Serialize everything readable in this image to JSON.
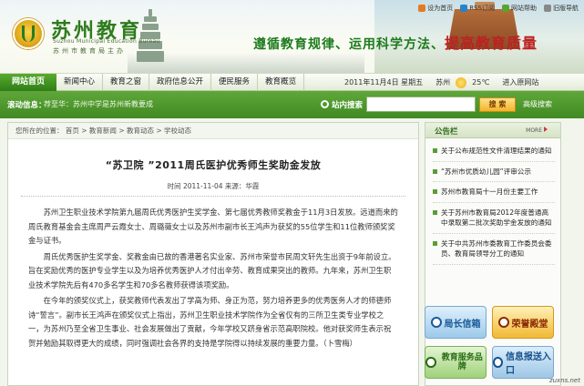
{
  "header": {
    "site_title": "苏州教育",
    "site_title_en": "Suzhou Municipal Education Bureau",
    "site_subtitle": "苏州市教育局主办",
    "slogan_part1": "遵循教育规律、运用科学方法、",
    "slogan_part2": "提高教育质量",
    "top_links": [
      {
        "label": "设为首页",
        "icon": "home-icon"
      },
      {
        "label": "RSS订阅",
        "icon": "rss-icon"
      },
      {
        "label": "网站帮助",
        "icon": "help-icon"
      },
      {
        "label": "旧版导航",
        "icon": "nav-icon"
      }
    ]
  },
  "nav": {
    "home": "网站首页",
    "items": [
      "新闻中心",
      "教育之窗",
      "政府信息公开",
      "便民服务",
      "教育概览"
    ],
    "date": "2011年11月4日 星期五",
    "city": "苏州",
    "temperature": "25℃",
    "enter_link": "进入原网站"
  },
  "bar": {
    "label": "滚动信息：",
    "ticker": "荐至华：苏州中学是苏州新教要成",
    "search_label": "站内搜索",
    "search_button": "搜 索",
    "advanced": "高级搜索"
  },
  "breadcrumb": "您所在的位置： 首页 > 教育新闻 > 教育动态 > 学校动态",
  "article": {
    "title": "“苏卫院 ”2011周氏医护优秀师生奖助金发放",
    "meta": "时间 2011-11-04 来源：华霞",
    "paragraphs": [
      "苏州卫生职业技术学院第九届周氏优秀医护生奖学金、第七届优秀教师奖教金于11月3日发放。远道而来的周氏教育基金会主席周严云霞女士、周璐薇女士以及苏州市副市长王鸿声为获奖的55位学生和11位教师颁奖奖金与证书。",
      "周氏优秀医护生奖学金、奖教金由已故的香港著名实业家、苏州市荣誉市民周文轩先生出资于9年前设立。旨在奖励优秀的医护专业学生以及为培养优秀医护人才付出辛劳、教育成果突出的教师。九年来，苏州卫生职业技术学院先后有470多名学生和70多名教师获得该项奖励。",
      "在今年的颁奖仪式上，获奖教师代表发出了学高为师、身正为范，努力培养更多的优秀医务人才的师德师诗“誓言”。副市长王鸿声在颁奖仪式上指出，苏州卫生职业技术学院作为全省仅有的三所卫生类专业学校之一，为苏州乃至全省卫生事业、社会发展做出了贡献，今年学校又跻身省示范高职院校。他对获奖师生表示祝贺并勉励其取得更大的成绩，同时强调社会各界的支持是学院得以持续发展的重要力量。（卜雪梅）"
    ]
  },
  "sidebar": {
    "title": "公告栏",
    "more": "MORE",
    "notices": [
      "关于公布规范性文件清理结果的通知",
      "“苏州市优质幼儿园”评审公示",
      "苏州市教育局十一月份主要工作",
      "关于苏州市教育局2012年度普通高中录取第二批次奖助学金发放的通知",
      "关于中共苏州市委教育工作委员会委员、教育局领导分工的通知"
    ]
  },
  "banners": [
    {
      "label": "局长信箱",
      "icon": "mail-icon"
    },
    {
      "label": "荣誉殿堂",
      "icon": "trophy-icon"
    },
    {
      "label": "教育服务品牌",
      "icon": "service-icon"
    },
    {
      "label": "信息报送入口",
      "icon": "upload-icon"
    }
  ],
  "watermark": "zuxns.net",
  "colors": {
    "brand_green": "#3f8a22",
    "accent_gold": "#f0b52a",
    "title_green": "#2e7b1d"
  }
}
